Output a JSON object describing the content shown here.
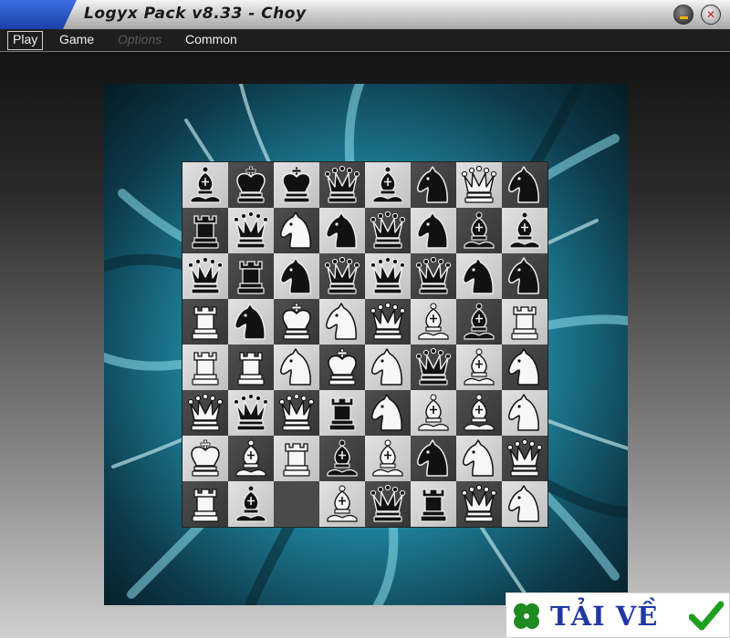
{
  "window": {
    "title": "Logyx Pack v8.33 - Choy"
  },
  "menu": [
    {
      "label": "Play",
      "state": "active"
    },
    {
      "label": "Game",
      "state": "normal"
    },
    {
      "label": "Options",
      "state": "disabled"
    },
    {
      "label": "Common",
      "state": "normal"
    }
  ],
  "board": {
    "rows": 8,
    "cols": 8,
    "cells": [
      [
        {
          "p": "bishop",
          "c": "black"
        },
        {
          "p": "king",
          "c": "black"
        },
        {
          "p": "king",
          "c": "black"
        },
        {
          "p": "queen",
          "c": "black"
        },
        {
          "p": "bishop",
          "c": "black"
        },
        {
          "p": "knight",
          "c": "black"
        },
        {
          "p": "queen",
          "c": "white"
        },
        {
          "p": "knight",
          "c": "black"
        }
      ],
      [
        {
          "p": "rook",
          "c": "black"
        },
        {
          "p": "queen",
          "c": "black"
        },
        {
          "p": "knight",
          "c": "white"
        },
        {
          "p": "knight",
          "c": "black"
        },
        {
          "p": "queen",
          "c": "black"
        },
        {
          "p": "knight",
          "c": "black"
        },
        {
          "p": "bishop",
          "c": "black"
        },
        {
          "p": "bishop",
          "c": "black"
        }
      ],
      [
        {
          "p": "queen",
          "c": "black"
        },
        {
          "p": "rook",
          "c": "black"
        },
        {
          "p": "knight",
          "c": "black"
        },
        {
          "p": "queen",
          "c": "black"
        },
        {
          "p": "queen",
          "c": "black"
        },
        {
          "p": "queen",
          "c": "black"
        },
        {
          "p": "knight",
          "c": "black"
        },
        {
          "p": "knight",
          "c": "black"
        }
      ],
      [
        {
          "p": "rook",
          "c": "white"
        },
        {
          "p": "knight",
          "c": "black"
        },
        {
          "p": "king",
          "c": "white"
        },
        {
          "p": "knight",
          "c": "white"
        },
        {
          "p": "queen",
          "c": "white"
        },
        {
          "p": "bishop",
          "c": "white"
        },
        {
          "p": "bishop",
          "c": "black"
        },
        {
          "p": "rook",
          "c": "white"
        }
      ],
      [
        {
          "p": "rook",
          "c": "white"
        },
        {
          "p": "rook",
          "c": "white"
        },
        {
          "p": "knight",
          "c": "white"
        },
        {
          "p": "king",
          "c": "white"
        },
        {
          "p": "knight",
          "c": "white"
        },
        {
          "p": "queen",
          "c": "black"
        },
        {
          "p": "bishop",
          "c": "white"
        },
        {
          "p": "knight",
          "c": "white"
        }
      ],
      [
        {
          "p": "queen",
          "c": "white"
        },
        {
          "p": "queen",
          "c": "black"
        },
        {
          "p": "queen",
          "c": "white"
        },
        {
          "p": "rook",
          "c": "black"
        },
        {
          "p": "knight",
          "c": "white"
        },
        {
          "p": "bishop",
          "c": "white"
        },
        {
          "p": "bishop",
          "c": "white"
        },
        {
          "p": "knight",
          "c": "white"
        }
      ],
      [
        {
          "p": "king",
          "c": "white"
        },
        {
          "p": "bishop",
          "c": "white"
        },
        {
          "p": "rook",
          "c": "white"
        },
        {
          "p": "bishop",
          "c": "black"
        },
        {
          "p": "bishop",
          "c": "white"
        },
        {
          "p": "knight",
          "c": "black"
        },
        {
          "p": "knight",
          "c": "white"
        },
        {
          "p": "queen",
          "c": "white"
        }
      ],
      [
        {
          "p": "rook",
          "c": "white"
        },
        {
          "p": "bishop",
          "c": "black"
        },
        null,
        {
          "p": "bishop",
          "c": "white"
        },
        {
          "p": "queen",
          "c": "black"
        },
        {
          "p": "rook",
          "c": "black"
        },
        {
          "p": "queen",
          "c": "white"
        },
        {
          "p": "knight",
          "c": "white"
        }
      ]
    ]
  },
  "badge": {
    "text": "TẢI VỀ"
  },
  "colors": {
    "title_accent": "#1c3fa8",
    "swirl_base": "#0d3a4a",
    "swirl_highlight": "#7fd8ea",
    "piece_black": "#111111",
    "piece_white": "#f7f7f7",
    "badge_text": "#2038a0",
    "clover": "#1f8a1f",
    "check": "#1f9e1f"
  }
}
